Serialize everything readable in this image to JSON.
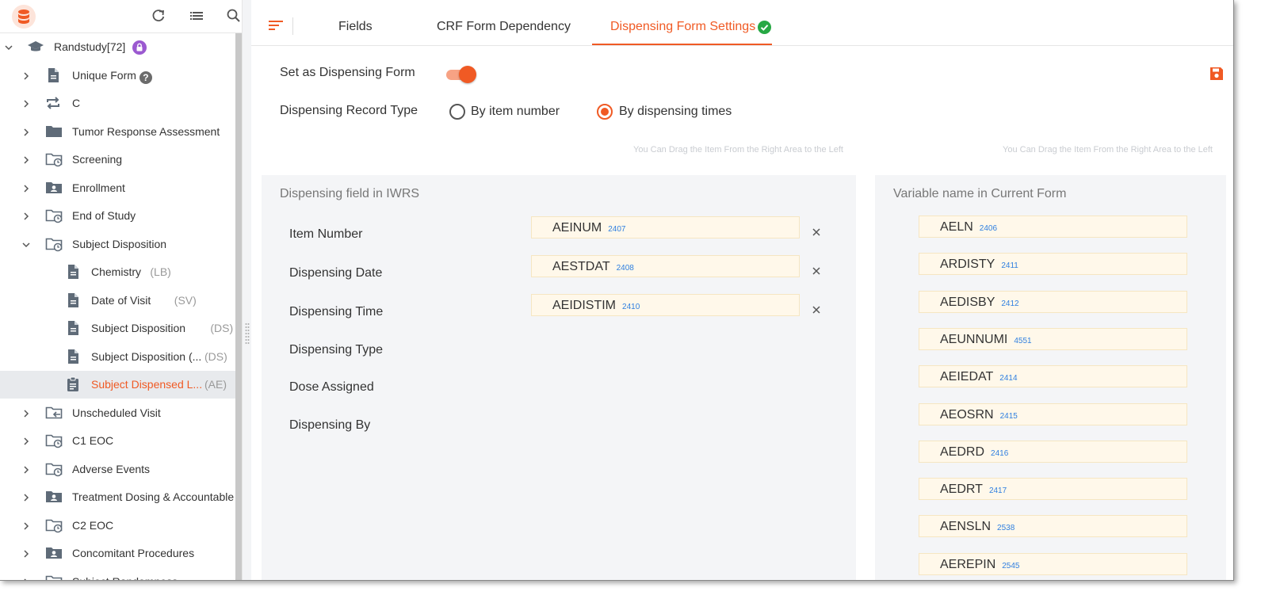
{
  "sidebar": {
    "tree": [
      {
        "label": "Randstudy[72]",
        "suffix": "",
        "icon": "graduation-cap-icon",
        "expanded": true,
        "level": 0
      },
      {
        "label": "Unique Form",
        "suffix": "",
        "icon": "document-icon",
        "expanded": false,
        "level": 1,
        "help": true
      },
      {
        "label": "C",
        "suffix": "",
        "icon": "repeat-icon",
        "expanded": false,
        "level": 1
      },
      {
        "label": "Tumor Response Assessment",
        "suffix": "",
        "icon": "folder-icon",
        "expanded": false,
        "level": 1
      },
      {
        "label": "Screening",
        "suffix": "",
        "icon": "folder-clock-icon",
        "expanded": false,
        "level": 1
      },
      {
        "label": "Enrollment",
        "suffix": "",
        "icon": "folder-person-icon",
        "expanded": false,
        "level": 1
      },
      {
        "label": "End of Study",
        "suffix": "",
        "icon": "folder-clock-icon",
        "expanded": false,
        "level": 1
      },
      {
        "label": "Subject Disposition",
        "suffix": "",
        "icon": "folder-clock-icon",
        "expanded": true,
        "level": 1
      },
      {
        "label": "Chemistry",
        "suffix": "(LB)",
        "icon": "document-icon",
        "level": 2
      },
      {
        "label": "Date of Visit",
        "suffix": "(SV)",
        "icon": "document-icon",
        "level": 2
      },
      {
        "label": "Subject Disposition",
        "suffix": "(DS)",
        "icon": "document-icon",
        "level": 2
      },
      {
        "label": "Subject Disposition (...",
        "suffix": "(DS)",
        "icon": "document-icon",
        "level": 2
      },
      {
        "label": "Subject Dispensed L...",
        "suffix": "(AE)",
        "icon": "clipboard-icon",
        "level": 2,
        "selected": true
      },
      {
        "label": "Unscheduled Visit",
        "suffix": "",
        "icon": "folder-arrow-icon",
        "expanded": false,
        "level": 1
      },
      {
        "label": "C1 EOC",
        "suffix": "",
        "icon": "folder-clock-icon",
        "expanded": false,
        "level": 1
      },
      {
        "label": "Adverse Events",
        "suffix": "",
        "icon": "folder-clock-icon",
        "expanded": false,
        "level": 1
      },
      {
        "label": "Treatment Dosing & Accountable",
        "suffix": "",
        "icon": "folder-person-icon",
        "expanded": false,
        "level": 1
      },
      {
        "label": "C2 EOC",
        "suffix": "",
        "icon": "folder-clock-icon",
        "expanded": false,
        "level": 1
      },
      {
        "label": "Concomitant Procedures",
        "suffix": "",
        "icon": "folder-person-icon",
        "expanded": false,
        "level": 1
      },
      {
        "label": "Subject Randomness",
        "suffix": "",
        "icon": "folder-clock-icon",
        "expanded": false,
        "level": 1
      }
    ]
  },
  "tabs": {
    "fields": "Fields",
    "crf": "CRF Form Dependency",
    "dispensing": "Dispensing Form Settings"
  },
  "settings": {
    "set_as_label": "Set as Dispensing Form",
    "set_as_enabled": true,
    "record_type_label": "Dispensing Record Type",
    "option_item_number": "By item number",
    "option_times": "By dispensing times",
    "selected_option": "By dispensing times",
    "hint_left": "You Can Drag the Item From the Right Area to the Left",
    "hint_right": "You Can Drag the Item From the Right Area to the Left"
  },
  "left_panel": {
    "title": "Dispensing field in IWRS",
    "fields": [
      {
        "label": "Item Number",
        "chip": "AEINUM",
        "chip_id": "2407"
      },
      {
        "label": "Dispensing Date",
        "chip": "AESTDAT",
        "chip_id": "2408"
      },
      {
        "label": "Dispensing Time",
        "chip": "AEIDISTIM",
        "chip_id": "2410"
      },
      {
        "label": "Dispensing Type"
      },
      {
        "label": "Dose Assigned"
      },
      {
        "label": "Dispensing By"
      }
    ]
  },
  "right_panel": {
    "title": "Variable name in Current Form",
    "variables": [
      {
        "name": "AELN",
        "id": "2406"
      },
      {
        "name": "ARDISTY",
        "id": "2411"
      },
      {
        "name": "AEDISBY",
        "id": "2412"
      },
      {
        "name": "AEUNNUMI",
        "id": "4551"
      },
      {
        "name": "AEIEDAT",
        "id": "2414"
      },
      {
        "name": "AEOSRN",
        "id": "2415"
      },
      {
        "name": "AEDRD",
        "id": "2416"
      },
      {
        "name": "AEDRT",
        "id": "2417"
      },
      {
        "name": "AENSLN",
        "id": "2538"
      },
      {
        "name": "AEREPIN",
        "id": "2545"
      }
    ]
  },
  "colors": {
    "accent": "#f05a24",
    "success": "#27a844",
    "chip_bg": "#fff8ea",
    "chip_id": "#2f7fe0",
    "lock_badge": "#9b59d0"
  }
}
